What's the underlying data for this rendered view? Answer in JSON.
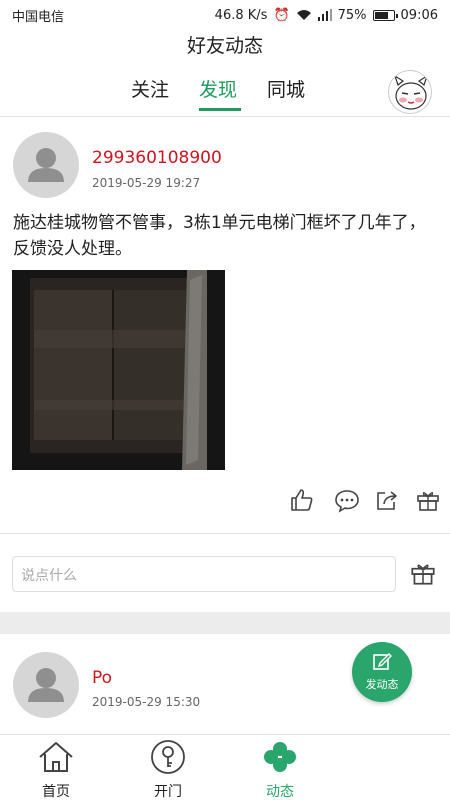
{
  "status": {
    "carrier": "中国电信",
    "speed": "46.8 K/s",
    "battery_pct": "75%",
    "battery_level": 0.75,
    "time": "09:06"
  },
  "header": {
    "title": "好友动态"
  },
  "tabs": [
    {
      "label": "关注",
      "active": false
    },
    {
      "label": "发现",
      "active": true
    },
    {
      "label": "同城",
      "active": false
    }
  ],
  "posts": [
    {
      "username": "299360108900",
      "time": "2019-05-29 19:27",
      "content": "施达桂城物管不管事，3栋1单元电梯门框坏了几年了，反馈没人处理。"
    },
    {
      "username": "Po",
      "time": "2019-05-29 15:30"
    }
  ],
  "comment": {
    "placeholder": "说点什么"
  },
  "fab": {
    "label": "发动态"
  },
  "nav": [
    {
      "label": "首页",
      "icon": "home-icon",
      "active": false
    },
    {
      "label": "开门",
      "icon": "key-icon",
      "active": false
    },
    {
      "label": "动态",
      "icon": "clover-icon",
      "active": true
    }
  ],
  "colors": {
    "accent": "#1f9b5e",
    "username": "#d0151f"
  }
}
